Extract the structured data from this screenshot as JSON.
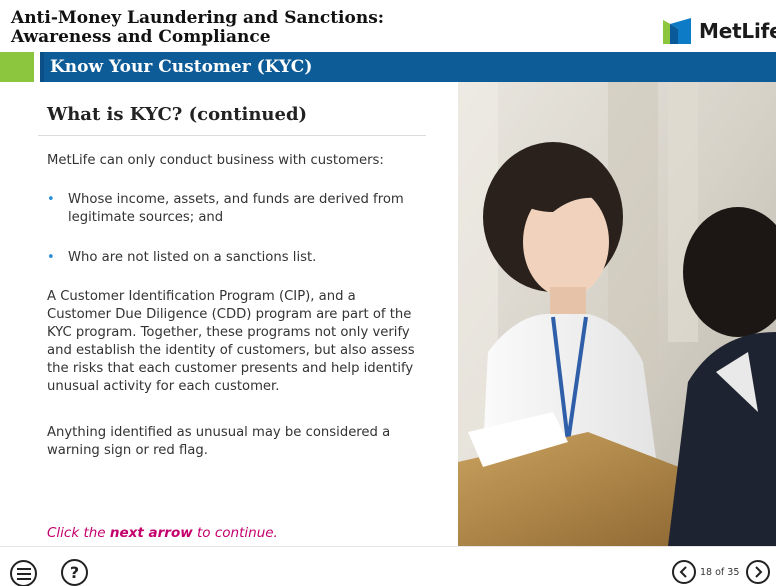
{
  "header": {
    "course_title_line1": "Anti-Money Laundering and Sanctions:",
    "course_title_line2": "Awareness and Compliance",
    "logo_text": "MetLife",
    "logo_colors": {
      "blue": "#0e5c97",
      "green": "#8cc63e"
    }
  },
  "section": {
    "title": "Know Your Customer (KYC)",
    "color": "#0e5c97",
    "accent": "#8cc63e"
  },
  "content": {
    "title": "What is KYC? (continued)",
    "intro": "MetLife can only conduct business with customers:",
    "bullets": [
      "Whose income, assets, and funds are derived from legitimate sources; and",
      "Who are not listed on a sanctions list."
    ],
    "paragraph_cip": "A Customer Identification Program (CIP), and a Customer Due Diligence (CDD) program are part of the KYC program. Together, these programs not only verify and establish the identity of customers, but also assess the risks that each customer presents and help identify unusual activity for each customer.",
    "paragraph_flag": "Anything identified as unusual may be considered a warning sign or red flag.",
    "cta_prefix": "Click the ",
    "cta_bold": "next arrow",
    "cta_suffix": " to continue.",
    "cta_color": "#c4006d"
  },
  "footer": {
    "menu_icon": "menu-icon",
    "help_icon": "help-icon",
    "help_glyph": "?",
    "prev_icon": "chevron-left-icon",
    "next_icon": "chevron-right-icon",
    "page_count": "18 of 35"
  }
}
